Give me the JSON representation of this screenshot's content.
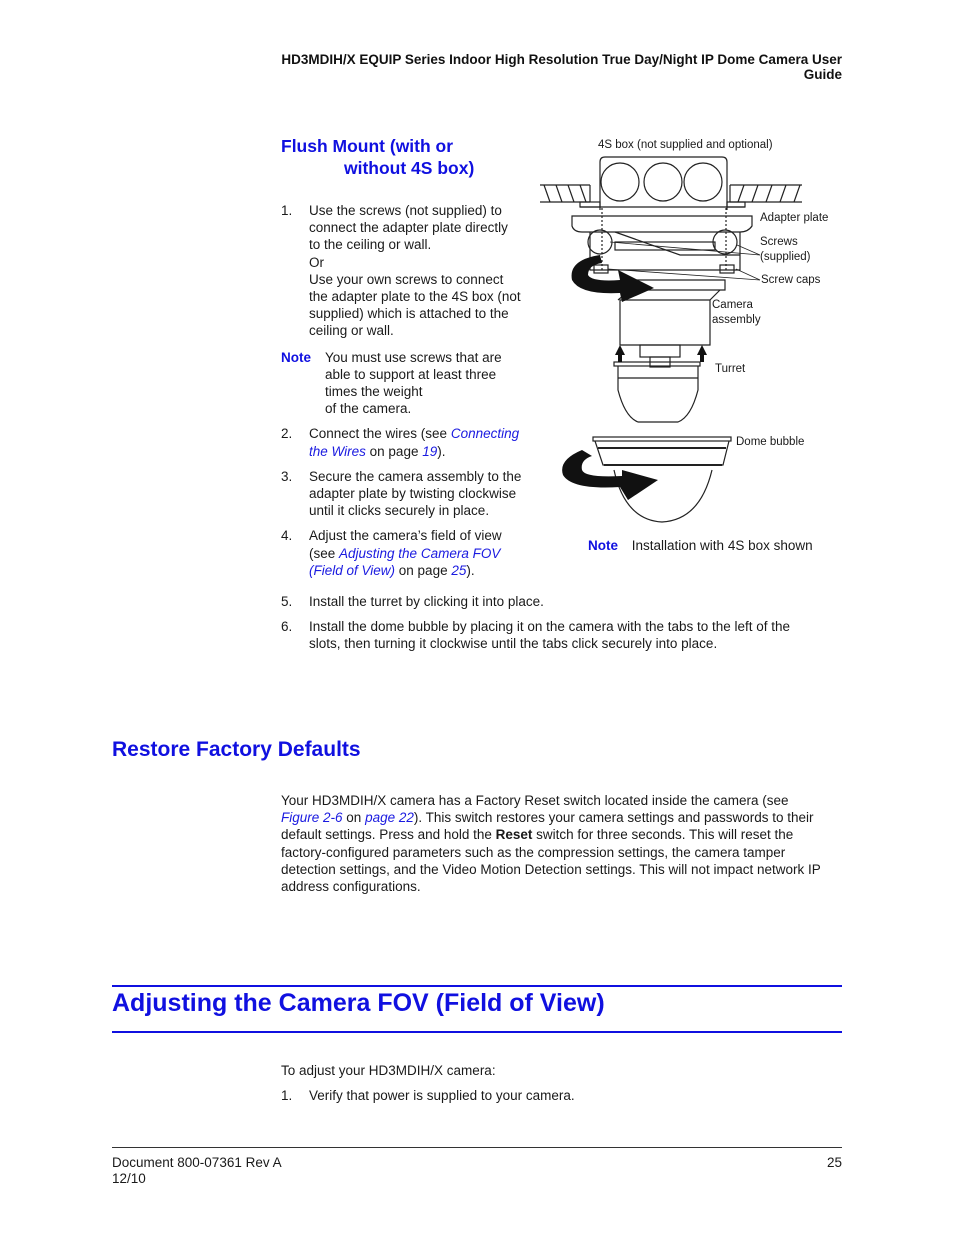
{
  "header": {
    "title": "HD3MDIH/X EQUIP Series Indoor High Resolution True Day/Night IP Dome Camera User Guide"
  },
  "flush_mount": {
    "heading_line1": "Flush Mount (with or",
    "heading_line2": "without 4S box)",
    "step1": {
      "num": "1.",
      "line1": "Use the screws (not supplied) to",
      "line2": "connect the adapter plate directly",
      "line3": "to the ceiling or wall.",
      "or": "Or",
      "line4": "Use your own screws to connect",
      "line5": "the adapter plate to the 4S box (not",
      "line6": "supplied) which is attached to the",
      "line7": "ceiling or wall."
    },
    "note": {
      "label": "Note",
      "line1": "You must use screws that are",
      "line2": "able to support at least three",
      "line3": "times the weight",
      "line4": "of the camera."
    },
    "step2": {
      "num": "2.",
      "pre": "Connect the wires (see ",
      "link1": "Connecting",
      "link2": "the Wires",
      "mid": " on page ",
      "page": "19",
      "post": ")."
    },
    "step3": {
      "num": "3.",
      "line1": "Secure the camera assembly to the",
      "line2": "adapter plate by twisting clockwise",
      "line3": "until it clicks securely in place."
    },
    "step4": {
      "num": "4.",
      "line1": "Adjust the camera’s field of view",
      "pre": "(see ",
      "link1": "Adjusting the Camera FOV",
      "link2": "(Field of View)",
      "mid": " on page ",
      "page": "25",
      "post": ")."
    },
    "step5": {
      "num": "5.",
      "text": "Install the turret by clicking it into place."
    },
    "step6": {
      "num": "6.",
      "line1": "Install the dome bubble by placing it on the camera with the tabs to the left of the",
      "line2": "slots, then turning it clockwise until the tabs click securely into place."
    }
  },
  "figure": {
    "labels": {
      "box": "4S box (not supplied and optional)",
      "adapter": "Adapter plate",
      "screws1": "Screws",
      "screws2": "(supplied)",
      "caps": "Screw caps",
      "camera1": "Camera",
      "camera2": "assembly",
      "turret": "Turret",
      "dome": "Dome bubble"
    },
    "note_label": "Note",
    "note_text": "Installation with 4S box shown"
  },
  "restore": {
    "heading": "Restore Factory Defaults",
    "p1": "Your HD3MDIH/X camera has a Factory Reset switch located inside the camera (see",
    "link_figure": "Figure 2-6",
    "on": " on ",
    "link_page": "page 22",
    "p2": "). This switch restores your camera settings and passwords to their",
    "p3a": "default settings. Press and hold the ",
    "reset": "Reset",
    "p3b": " switch for three seconds. This will reset the",
    "p4": "factory-configured parameters such as the compression settings, the camera tamper",
    "p5": "detection settings, and the Video Motion Detection settings. This will not impact network IP",
    "p6": "address configurations."
  },
  "fov": {
    "heading": "Adjusting the Camera FOV (Field of View)",
    "intro": "To adjust your HD3MDIH/X camera:",
    "step1_num": "1.",
    "step1": "Verify that power is supplied to your camera."
  },
  "footer": {
    "doc": "Document 800-07361 Rev A",
    "date": "12/10",
    "page": "25"
  }
}
